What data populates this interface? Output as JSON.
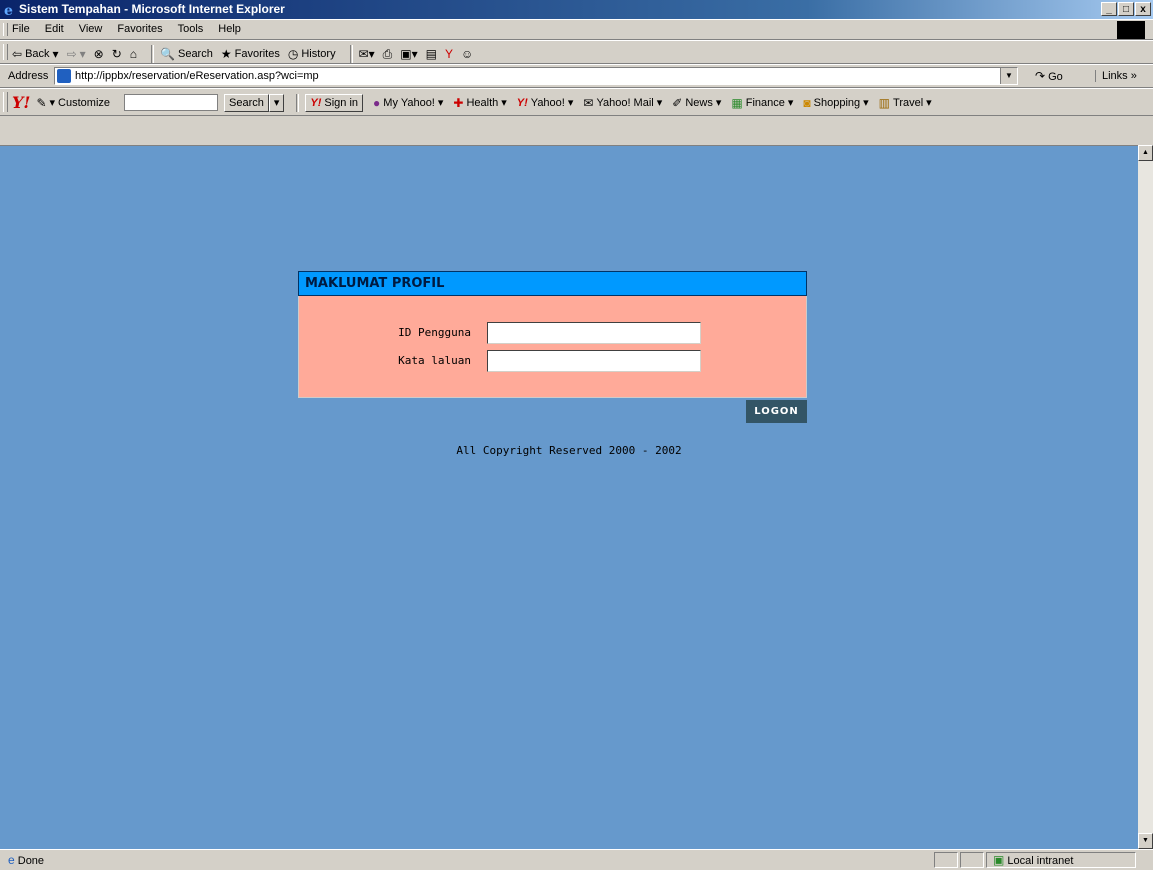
{
  "window": {
    "title": "Sistem Tempahan - Microsoft Internet Explorer",
    "controls": [
      "_",
      "□",
      "x"
    ]
  },
  "menu": [
    "File",
    "Edit",
    "View",
    "Favorites",
    "Tools",
    "Help"
  ],
  "toolbar": {
    "back": "Back",
    "search": "Search",
    "favorites": "Favorites",
    "history": "History"
  },
  "address": {
    "label": "Address",
    "url": "http://ippbx/reservation/eReservation.asp?wci=mp",
    "go": "Go",
    "links": "Links"
  },
  "yahoo": {
    "customize": "Customize",
    "search_button": "Search",
    "sign_in": "Sign in",
    "items": [
      "My Yahoo!",
      "Health",
      "Yahoo!",
      "Yahoo! Mail",
      "News",
      "Finance",
      "Shopping",
      "Travel"
    ]
  },
  "page": {
    "header": "MAKLUMAT PROFIL",
    "user_id_label": "ID Pengguna",
    "password_label": "Kata laluan",
    "user_id_value": "",
    "password_value": "",
    "logon": "LOGON",
    "copyright": "All Copyright Reserved 2000 - 2002"
  },
  "status": {
    "text": "Done",
    "zone": "Local intranet"
  },
  "colors": {
    "background": "#6699cc",
    "header": "#0099ff",
    "form_body": "#ffaa99",
    "logon_button": "#335566"
  }
}
